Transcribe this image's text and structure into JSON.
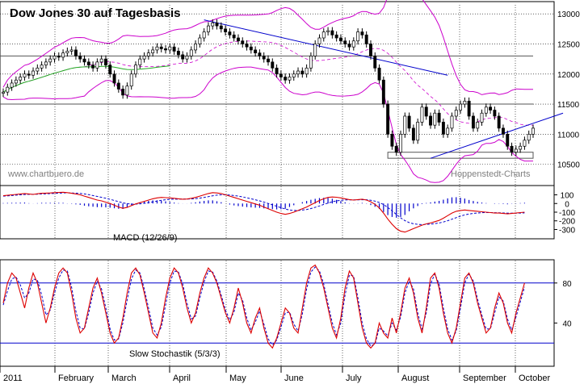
{
  "chart_data": [
    {
      "panel": "price",
      "type": "candlestick",
      "title": "Dow Jones 30 auf Tagesbasis",
      "watermark_left": "www.chartbuero.de",
      "watermark_right": "Hoppenstedt-Charts",
      "yticks": [
        10500,
        11000,
        11500,
        12000,
        12500,
        13000
      ],
      "ylim": [
        10200,
        13150
      ],
      "horizontal_lines": [
        11500,
        12300
      ],
      "channel_box_bottom": [
        10600,
        10700
      ],
      "close_series": [
        11700,
        11780,
        11850,
        11900,
        11950,
        12000,
        11980,
        12050,
        12100,
        12150,
        12200,
        12250,
        12300,
        12280,
        12350,
        12380,
        12400,
        12300,
        12250,
        12200,
        12150,
        12100,
        12200,
        12250,
        12150,
        12000,
        11850,
        11750,
        11650,
        11800,
        12000,
        12150,
        12250,
        12300,
        12350,
        12400,
        12450,
        12420,
        12400,
        12450,
        12380,
        12320,
        12250,
        12300,
        12400,
        12500,
        12600,
        12700,
        12800,
        12850,
        12800,
        12750,
        12700,
        12650,
        12600,
        12550,
        12500,
        12450,
        12400,
        12350,
        12300,
        12250,
        12200,
        12100,
        12000,
        11950,
        11900,
        11950,
        12000,
        12050,
        12000,
        12100,
        12300,
        12500,
        12600,
        12700,
        12720,
        12650,
        12600,
        12550,
        12500,
        12450,
        12550,
        12700,
        12650,
        12500,
        12300,
        12100,
        11900,
        11500,
        11000,
        10800,
        10700,
        11000,
        11300,
        11100,
        10900,
        11200,
        11450,
        11300,
        11150,
        11350,
        11200,
        11000,
        11100,
        11300,
        11400,
        11500,
        11550,
        11300,
        11100,
        11200,
        11350,
        11450,
        11400,
        11300,
        11100,
        11000,
        10800,
        10700,
        10750,
        10800,
        10900,
        11000,
        11100
      ]
    },
    {
      "panel": "macd",
      "type": "line",
      "label": "MACD (12/26/9)",
      "yticks": [
        100,
        0,
        -100,
        -200,
        -300
      ],
      "ylim": [
        -370,
        170
      ],
      "series": [
        {
          "kind": "macd",
          "values": [
            90,
            95,
            100,
            105,
            110,
            115,
            110,
            105,
            112,
            118,
            120,
            122,
            125,
            128,
            130,
            125,
            118,
            110,
            100,
            85,
            70,
            55,
            40,
            30,
            15,
            0,
            -20,
            -40,
            -55,
            -45,
            -25,
            -5,
            10,
            25,
            40,
            55,
            65,
            70,
            68,
            65,
            60,
            55,
            50,
            52,
            60,
            70,
            85,
            100,
            115,
            125,
            122,
            115,
            100,
            85,
            70,
            55,
            40,
            25,
            10,
            -5,
            -20,
            -40,
            -60,
            -80,
            -100,
            -115,
            -125,
            -115,
            -100,
            -80,
            -60,
            -40,
            -15,
            10,
            35,
            55,
            70,
            75,
            72,
            65,
            55,
            45,
            40,
            45,
            50,
            40,
            20,
            -10,
            -50,
            -110,
            -180,
            -240,
            -290,
            -320,
            -330,
            -310,
            -290,
            -270,
            -250,
            -235,
            -225,
            -210,
            -195,
            -170,
            -140,
            -110,
            -90,
            -80,
            -75,
            -80,
            -85,
            -90,
            -95,
            -100,
            -105,
            -110,
            -110,
            -115,
            -120,
            -115,
            -110,
            -105,
            -100
          ]
        },
        {
          "kind": "signal",
          "values": [
            85,
            88,
            92,
            96,
            100,
            104,
            106,
            106,
            108,
            110,
            112,
            114,
            117,
            120,
            122,
            123,
            122,
            120,
            116,
            110,
            102,
            92,
            82,
            71,
            60,
            48,
            35,
            21,
            8,
            -2,
            -7,
            -7,
            -4,
            2,
            10,
            19,
            28,
            37,
            43,
            48,
            50,
            51,
            51,
            51,
            53,
            56,
            62,
            70,
            79,
            89,
            96,
            100,
            100,
            97,
            92,
            85,
            76,
            66,
            55,
            43,
            30,
            16,
            1,
            -15,
            -32,
            -49,
            -64,
            -75,
            -80,
            -80,
            -76,
            -69,
            -58,
            -44,
            -28,
            -11,
            5,
            20,
            30,
            37,
            41,
            42,
            42,
            42,
            43,
            43,
            38,
            28,
            12,
            -12,
            -46,
            -85,
            -126,
            -165,
            -198,
            -220,
            -234,
            -241,
            -243,
            -241,
            -238,
            -232,
            -225,
            -214,
            -199,
            -181,
            -163,
            -146,
            -132,
            -121,
            -114,
            -109,
            -106,
            -105,
            -105,
            -106,
            -107,
            -109,
            -111,
            -112,
            -112,
            -110,
            -108
          ]
        },
        {
          "kind": "histogram",
          "values": [
            5,
            7,
            8,
            9,
            10,
            11,
            4,
            -1,
            4,
            8,
            8,
            8,
            8,
            8,
            8,
            2,
            -4,
            -10,
            -16,
            -25,
            -32,
            -37,
            -42,
            -41,
            -45,
            -48,
            -55,
            -61,
            -63,
            -43,
            -18,
            2,
            14,
            23,
            30,
            36,
            37,
            33,
            25,
            17,
            10,
            4,
            -1,
            1,
            7,
            14,
            23,
            30,
            36,
            36,
            26,
            15,
            0,
            -12,
            -22,
            -30,
            -36,
            -41,
            -45,
            -48,
            -50,
            -56,
            -61,
            -65,
            -68,
            -66,
            -61,
            -40,
            -20,
            0,
            16,
            29,
            43,
            54,
            63,
            66,
            65,
            55,
            42,
            28,
            14,
            3,
            -2,
            3,
            7,
            -3,
            -18,
            -38,
            -62,
            -98,
            -134,
            -155,
            -164,
            -155,
            -132,
            -90,
            -56,
            -29,
            -7,
            6,
            13,
            22,
            30,
            44,
            59,
            71,
            73,
            66,
            57,
            41,
            29,
            19,
            11,
            5,
            0,
            -4,
            -3,
            -6,
            -9,
            -3,
            2,
            5,
            8
          ]
        }
      ]
    },
    {
      "panel": "stochastic",
      "type": "line",
      "label": "Slow Stochastik (5/3/3)",
      "yticks": [
        40,
        80
      ],
      "ylim": [
        0,
        100
      ],
      "horizontal_lines": [
        20,
        80
      ],
      "series": [
        {
          "kind": "k",
          "values": [
            60,
            80,
            90,
            85,
            70,
            55,
            75,
            90,
            80,
            60,
            40,
            55,
            75,
            90,
            95,
            90,
            70,
            45,
            30,
            35,
            55,
            75,
            85,
            70,
            50,
            30,
            20,
            25,
            45,
            70,
            90,
            95,
            88,
            70,
            50,
            30,
            25,
            40,
            65,
            85,
            95,
            90,
            75,
            55,
            40,
            50,
            70,
            85,
            95,
            90,
            80,
            65,
            50,
            40,
            55,
            75,
            60,
            40,
            30,
            45,
            55,
            35,
            20,
            15,
            25,
            40,
            55,
            50,
            35,
            30,
            55,
            80,
            95,
            98,
            90,
            75,
            55,
            35,
            25,
            45,
            75,
            92,
            85,
            60,
            35,
            20,
            15,
            20,
            40,
            30,
            25,
            45,
            30,
            50,
            75,
            85,
            70,
            45,
            30,
            55,
            85,
            90,
            75,
            50,
            30,
            20,
            35,
            60,
            85,
            90,
            80,
            60,
            45,
            30,
            35,
            55,
            70,
            60,
            40,
            30,
            50,
            65,
            80
          ]
        },
        {
          "kind": "d",
          "values": [
            58,
            72,
            84,
            86,
            78,
            65,
            70,
            84,
            83,
            68,
            48,
            53,
            70,
            85,
            93,
            92,
            76,
            52,
            35,
            34,
            50,
            70,
            82,
            74,
            55,
            34,
            23,
            24,
            40,
            63,
            84,
            93,
            90,
            74,
            55,
            35,
            28,
            36,
            58,
            80,
            92,
            91,
            79,
            60,
            44,
            47,
            65,
            81,
            92,
            91,
            82,
            68,
            53,
            43,
            51,
            70,
            63,
            45,
            33,
            41,
            52,
            39,
            24,
            18,
            23,
            36,
            50,
            51,
            39,
            32,
            49,
            74,
            91,
            96,
            92,
            79,
            59,
            40,
            28,
            40,
            68,
            88,
            87,
            65,
            40,
            24,
            17,
            19,
            35,
            32,
            27,
            40,
            33,
            46,
            70,
            82,
            74,
            50,
            34,
            50,
            79,
            89,
            79,
            55,
            34,
            23,
            32,
            55,
            80,
            89,
            82,
            64,
            48,
            34,
            34,
            50,
            66,
            62,
            44,
            33,
            46,
            61,
            76
          ]
        }
      ]
    }
  ],
  "x_axis": {
    "labels": [
      "2011",
      "February",
      "March",
      "April",
      "May",
      "June",
      "July",
      "August",
      "September",
      "October"
    ]
  },
  "colors": {
    "candle_up": "#ffffff",
    "candle_down": "#000000",
    "bollinger": "#cc00cc",
    "ma_long": "#22aa22",
    "trend": "#0000cc",
    "macd_line": "#dd0000",
    "signal_line": "#0000cc",
    "stoch_k": "#dd0000",
    "stoch_d": "#0000cc",
    "guide": "#0000cc"
  }
}
